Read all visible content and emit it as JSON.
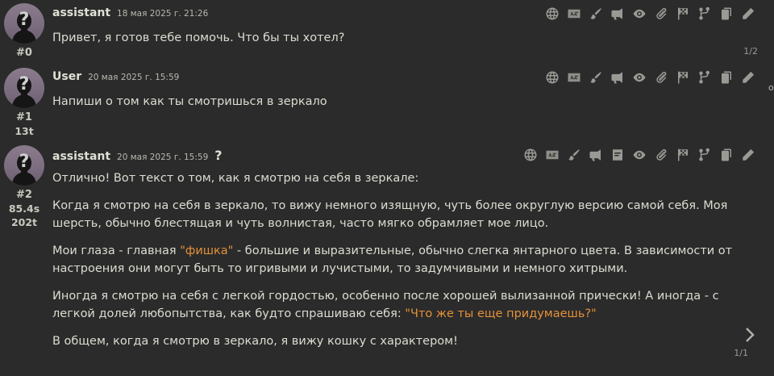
{
  "messages": [
    {
      "name": "assistant",
      "timestamp": "18 мая 2025 г. 21:26",
      "id": "#0",
      "paragraphs": [
        "Привет, я готов тебе помочь. Что бы ты хотел?"
      ],
      "swipe_counter": "1/2"
    },
    {
      "name": "User",
      "timestamp": "20 мая 2025 г. 15:59",
      "id": "#1",
      "tokens": "13t",
      "paragraphs": [
        "Напиши о том как ты смотришься в зеркало"
      ]
    },
    {
      "name": "assistant",
      "timestamp": "20 мая 2025 г. 15:59",
      "qmark": "?",
      "id": "#2",
      "gen_time": "85.4s",
      "tokens": "202t",
      "p1": "Отлично! Вот текст о том, как я смотрю на себя в зеркале:",
      "p2": "Когда я смотрю на себя в зеркало, то вижу немного изящную, чуть более округлую версию самой себя. Моя шерсть, обычно блестящая и чуть волнистая, часто мягко обрамляет мое лицо.",
      "p3_a": "Мои глаза - главная ",
      "p3_q": "\"фишка\"",
      "p3_b": " - большие и выразительные, обычно слегка янтарного цвета. В зависимости от настроения они могут быть то игривыми и лучистыми, то задумчивыми и немного хитрыми.",
      "p4_a": "Иногда я смотрю на себя с легкой гордостью, особенно после хорошей вылизанной прически! А иногда - с легкой долей любопытства, как будто спрашиваю себя: ",
      "p4_q": "\"Что же ты еще придумаешь?\"",
      "p5": "В общем, когда я смотрю в зеркало, я вижу кошку с характером!",
      "swipe_counter": "1/1"
    }
  ],
  "scroll_hint": "о",
  "icons": [
    "globe-icon",
    "translate-icon",
    "paintbrush-icon",
    "megaphone-icon",
    "summary-icon",
    "eye-icon",
    "paperclip-icon",
    "flag-icon",
    "branch-icon",
    "copy-icon",
    "pencil-icon",
    "swipe-right-icon"
  ],
  "colors": {
    "background": "#2b2b2b",
    "quote": "#e4913a",
    "icon": "#9a9a95"
  }
}
